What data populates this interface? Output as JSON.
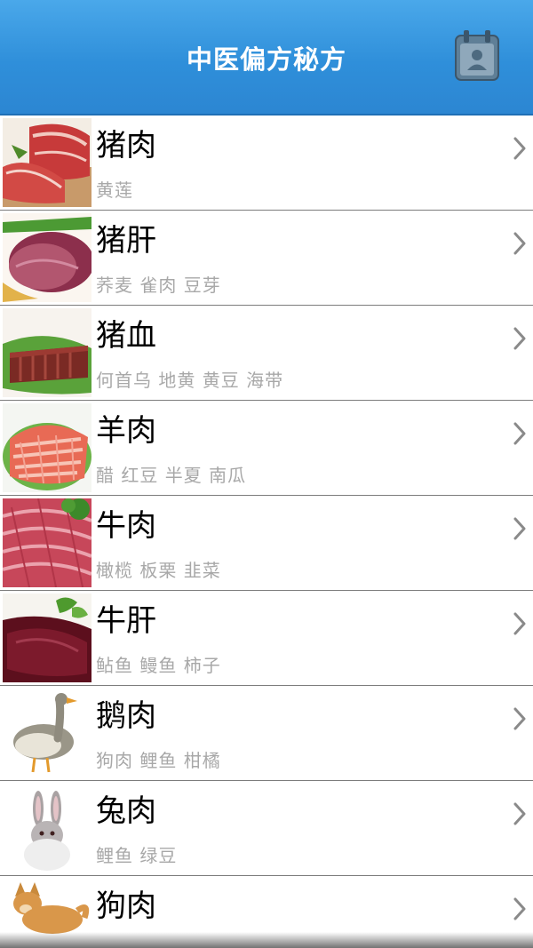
{
  "header": {
    "title": "中医偏方秘方",
    "calendar_icon": "calendar-contact-icon"
  },
  "items": [
    {
      "name": "猪肉",
      "pairs": "黄莲",
      "thumb": "pork-image"
    },
    {
      "name": "猪肝",
      "pairs": "荞麦 雀肉 豆芽",
      "thumb": "pork-liver-image"
    },
    {
      "name": "猪血",
      "pairs": "何首乌 地黄 黄豆 海带",
      "thumb": "pig-blood-image"
    },
    {
      "name": "羊肉",
      "pairs": "醋 红豆 半夏 南瓜",
      "thumb": "mutton-image"
    },
    {
      "name": "牛肉",
      "pairs": "橄榄 板栗 韭菜",
      "thumb": "beef-image"
    },
    {
      "name": "牛肝",
      "pairs": "鲇鱼 鳗鱼 柿子",
      "thumb": "beef-liver-image"
    },
    {
      "name": "鹅肉",
      "pairs": "狗肉 鲤鱼 柑橘",
      "thumb": "goose-image"
    },
    {
      "name": "兔肉",
      "pairs": "鲤鱼 绿豆",
      "thumb": "rabbit-image"
    },
    {
      "name": "狗肉",
      "pairs": "",
      "thumb": "dog-image"
    }
  ],
  "colors": {
    "header_top": "#4aa8ea",
    "header_bottom": "#2c86d2",
    "subtext": "#a8a8a8",
    "chevron": "#8a8a8a"
  }
}
